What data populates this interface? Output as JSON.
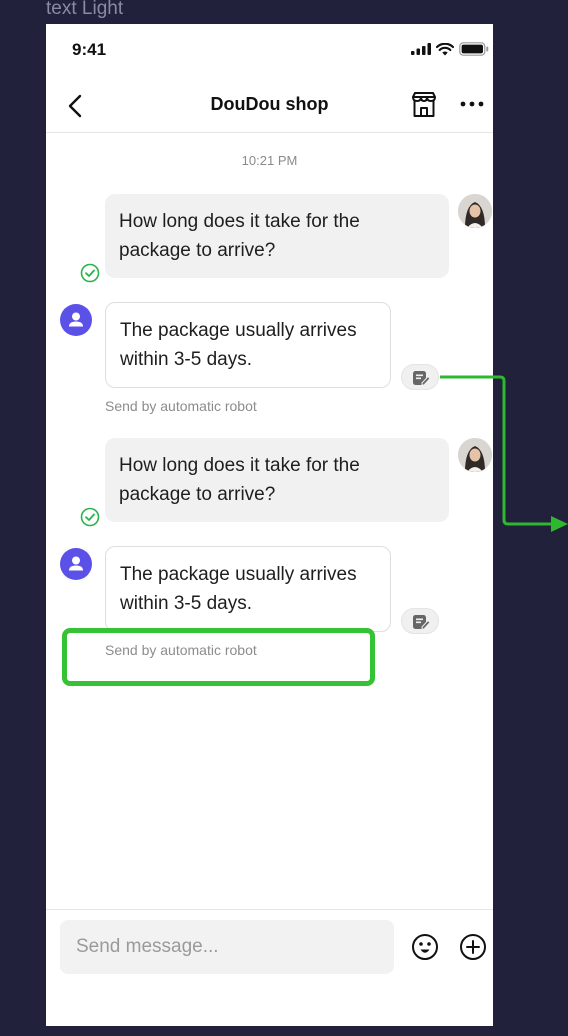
{
  "canvas_label": "text Light",
  "status_bar": {
    "time": "9:41"
  },
  "header": {
    "title": "DouDou shop"
  },
  "timestamp": "10:21 PM",
  "messages": [
    {
      "sender": "user",
      "text": "How long does it take for the package to arrive?"
    },
    {
      "sender": "bot",
      "text": "The package usually arrives within 3-5 days.",
      "note": "Send by automatic robot"
    },
    {
      "sender": "user",
      "text": "How long does it take for the package to arrive?"
    },
    {
      "sender": "bot",
      "text": "The package usually arrives within 3-5 days.",
      "note": "Send by automatic robot"
    }
  ],
  "input": {
    "placeholder": "Send message..."
  },
  "colors": {
    "highlight": "#35c335",
    "bot_avatar": "#5b50e8",
    "read_check": "#2bb24c",
    "background": "#21213b"
  }
}
